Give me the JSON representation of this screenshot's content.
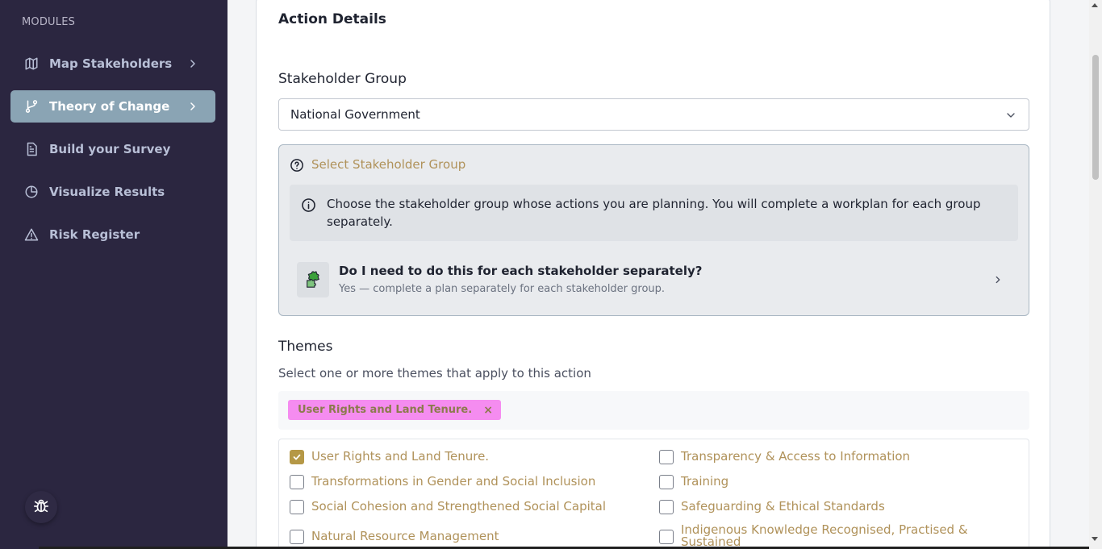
{
  "sidebar": {
    "section_label": "MODULES",
    "items": [
      {
        "label": "Map Stakeholders",
        "icon": "map-icon"
      },
      {
        "label": "Theory of Change",
        "icon": "git-branch-icon",
        "active": true
      },
      {
        "label": "Build your Survey",
        "icon": "document-icon"
      },
      {
        "label": "Visualize Results",
        "icon": "pie-chart-icon"
      },
      {
        "label": "Risk Register",
        "icon": "warning-icon"
      }
    ],
    "bug_button_icon": "bug-icon"
  },
  "form": {
    "title": "Action Details",
    "stakeholder_group": {
      "label": "Stakeholder Group",
      "value": "National Government"
    },
    "help": {
      "heading": "Select Stakeholder Group",
      "info": "Choose the stakeholder group whose actions you are planning. You will complete a workplan for each group separately.",
      "faq_question": "Do I need to do this for each stakeholder separately?",
      "faq_answer": "Yes — complete a plan separately for each stakeholder group."
    },
    "themes": {
      "title": "Themes",
      "subtitle": "Select one or more themes that apply to this action",
      "selected_chip": "User Rights and Land Tenure.",
      "chip_remove": "×",
      "options": [
        {
          "label": "User Rights and Land Tenure.",
          "checked": true
        },
        {
          "label": "Transparency & Access to Information",
          "checked": false
        },
        {
          "label": "Transformations in Gender and Social Inclusion",
          "checked": false
        },
        {
          "label": "Training",
          "checked": false
        },
        {
          "label": "Social Cohesion and Strengthened Social Capital",
          "checked": false
        },
        {
          "label": "Safeguarding & Ethical Standards",
          "checked": false
        },
        {
          "label": "Natural Resource Management",
          "checked": false
        },
        {
          "label": "Indigenous Knowledge Recognised, Practised & Sustained",
          "checked": false
        }
      ]
    }
  },
  "colors": {
    "sidebar_bg": "#2b2640",
    "active_item": "#8aa4b4",
    "accent_text": "#b0925a",
    "chip_bg": "#f58cf0"
  }
}
